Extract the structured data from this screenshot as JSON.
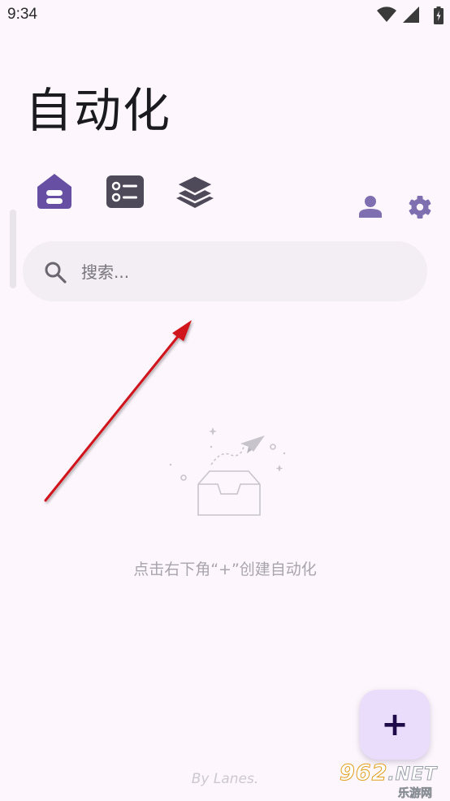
{
  "status_bar": {
    "time": "9:34",
    "icons": [
      "wifi-icon",
      "cell-signal-icon",
      "battery-charging-icon"
    ]
  },
  "header": {
    "title": "自动化"
  },
  "tabs": [
    {
      "icon": "home-icon",
      "active": true
    },
    {
      "icon": "list-icon",
      "active": false
    },
    {
      "icon": "layers-icon",
      "active": false
    }
  ],
  "toolbar": {
    "icons": [
      "person-icon",
      "gear-icon"
    ]
  },
  "search": {
    "placeholder": "搜索..."
  },
  "empty_state": {
    "icon": "empty-inbox-icon",
    "message": "点击右下角“+”创建自动化"
  },
  "fab": {
    "label": "+"
  },
  "footer": {
    "credit": "By Lanes."
  },
  "watermark": {
    "brand": "962",
    "suffix": ".NET",
    "subtitle": "乐游网"
  },
  "colors": {
    "accent": "#6750a4",
    "icon_dark": "#4f4a5a",
    "surface": "#fdf7fd",
    "search_bg": "#f2eef3",
    "fab_bg": "#eadcfb",
    "annotation_arrow": "#d0121b"
  }
}
